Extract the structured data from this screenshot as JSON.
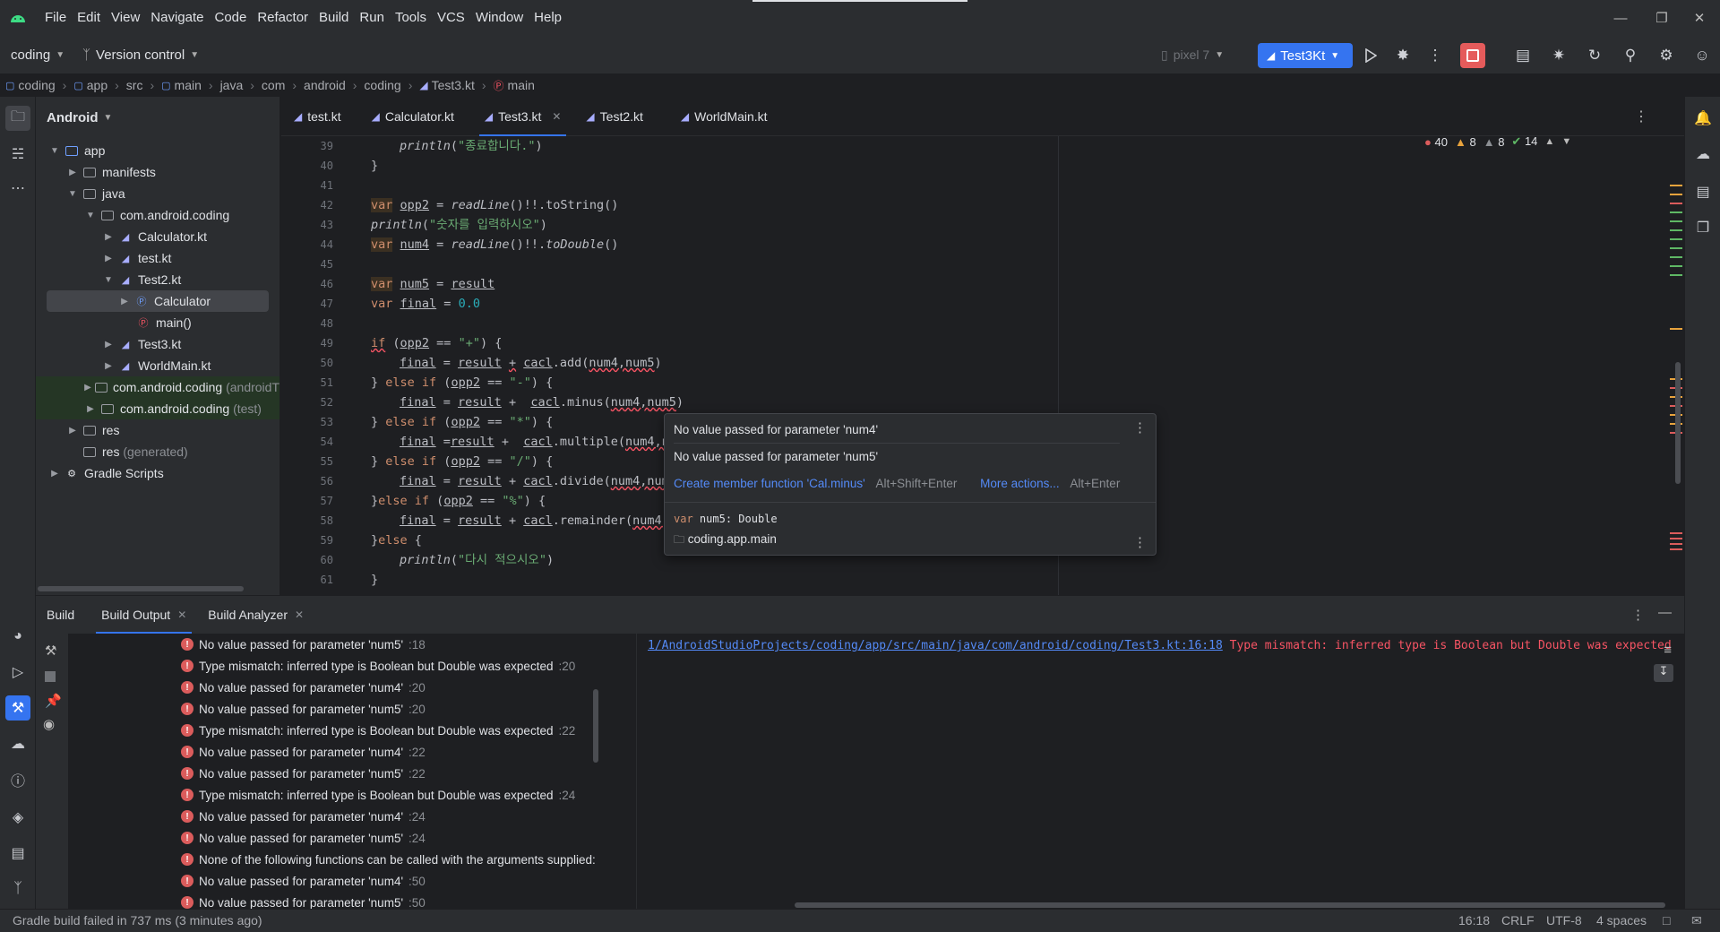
{
  "menu": [
    "File",
    "Edit",
    "View",
    "Navigate",
    "Code",
    "Refactor",
    "Build",
    "Run",
    "Tools",
    "VCS",
    "Window",
    "Help"
  ],
  "toolbar": {
    "project": "coding",
    "vcs": "Version control",
    "device": "pixel 7",
    "run_config": "Test3Kt"
  },
  "breadcrumb": [
    "coding",
    "app",
    "src",
    "main",
    "java",
    "com",
    "android",
    "coding",
    "Test3.kt",
    "main"
  ],
  "project_panel": {
    "title": "Android",
    "tree": [
      {
        "label": "app",
        "extra": ""
      },
      {
        "label": "manifests",
        "extra": ""
      },
      {
        "label": "java",
        "extra": ""
      },
      {
        "label": "com.android.coding",
        "extra": ""
      },
      {
        "label": "Calculator.kt",
        "extra": ""
      },
      {
        "label": "test.kt",
        "extra": ""
      },
      {
        "label": "Test2.kt",
        "extra": ""
      },
      {
        "label": "Calculator",
        "extra": ""
      },
      {
        "label": "main()",
        "extra": ""
      },
      {
        "label": "Test3.kt",
        "extra": ""
      },
      {
        "label": "WorldMain.kt",
        "extra": ""
      },
      {
        "label": "com.android.coding",
        "extra": "(androidT"
      },
      {
        "label": "com.android.coding",
        "extra": "(test)"
      },
      {
        "label": "res",
        "extra": ""
      },
      {
        "label": "res",
        "extra": "(generated)"
      },
      {
        "label": "Gradle Scripts",
        "extra": ""
      }
    ]
  },
  "editor": {
    "tabs": [
      "test.kt",
      "Calculator.kt",
      "Test3.kt",
      "Test2.kt",
      "WorldMain.kt"
    ],
    "active_tab": "Test3.kt",
    "line_numbers": [
      "39",
      "40",
      "41",
      "42",
      "43",
      "44",
      "45",
      "46",
      "47",
      "48",
      "49",
      "50",
      "51",
      "52",
      "53",
      "54",
      "55",
      "56",
      "57",
      "58",
      "59",
      "60",
      "61"
    ],
    "inspections": {
      "errors": "40",
      "warnings": "8",
      "weak_warnings": "8",
      "ok": "14"
    },
    "code": {
      "l39_str": "\"종료합니다.\"",
      "l43_str": "\"숫자를 입력하시오\"",
      "l49_str": "\"+\"",
      "l51_str": "\"-\"",
      "l53_str": "\"*\"",
      "l55_str": "\"/\"",
      "l57_str": "\"%\"",
      "l60_str": "\"다시 적으시오\"",
      "l47_num": "0.0"
    }
  },
  "popup": {
    "line1": "No value passed for parameter 'num4'",
    "line2": "No value passed for parameter 'num5'",
    "action1": "Create member function 'Cal.minus'",
    "action1_shortcut": "Alt+Shift+Enter",
    "action2": "More actions...",
    "action2_shortcut": "Alt+Enter",
    "decl_kw": "var",
    "decl": "num5: Double",
    "location": "coding.app.main"
  },
  "build": {
    "tabs": [
      "Build",
      "Build Output",
      "Build Analyzer"
    ],
    "rows": [
      {
        "msg": "No value passed for parameter 'num5'",
        "line": ":18"
      },
      {
        "msg": "Type mismatch: inferred type is Boolean but Double was expected",
        "line": ":20"
      },
      {
        "msg": "No value passed for parameter 'num4'",
        "line": ":20"
      },
      {
        "msg": "No value passed for parameter 'num5'",
        "line": ":20"
      },
      {
        "msg": "Type mismatch: inferred type is Boolean but Double was expected",
        "line": ":22"
      },
      {
        "msg": "No value passed for parameter 'num4'",
        "line": ":22"
      },
      {
        "msg": "No value passed for parameter 'num5'",
        "line": ":22"
      },
      {
        "msg": "Type mismatch: inferred type is Boolean but Double was expected",
        "line": ":24"
      },
      {
        "msg": "No value passed for parameter 'num4'",
        "line": ":24"
      },
      {
        "msg": "No value passed for parameter 'num5'",
        "line": ":24"
      },
      {
        "msg": "None of the following functions can be called with the arguments supplied:",
        "line": ""
      },
      {
        "msg": "No value passed for parameter 'num4'",
        "line": ":50"
      },
      {
        "msg": "No value passed for parameter 'num5'",
        "line": ":50"
      }
    ],
    "output_path": "1/AndroidStudioProjects/coding/app/src/main/java/com/android/coding/Test3.kt:16:18",
    "output_error": "Type mismatch: inferred type is Boolean but Double was expected"
  },
  "status": {
    "message": "Gradle build failed in 737 ms (3 minutes ago)",
    "position": "16:18",
    "line_sep": "CRLF",
    "encoding": "UTF-8",
    "indent": "4 spaces"
  },
  "colors": {
    "accent": "#3574f0",
    "error": "#db5c5c",
    "stop": "#e55b5b"
  }
}
